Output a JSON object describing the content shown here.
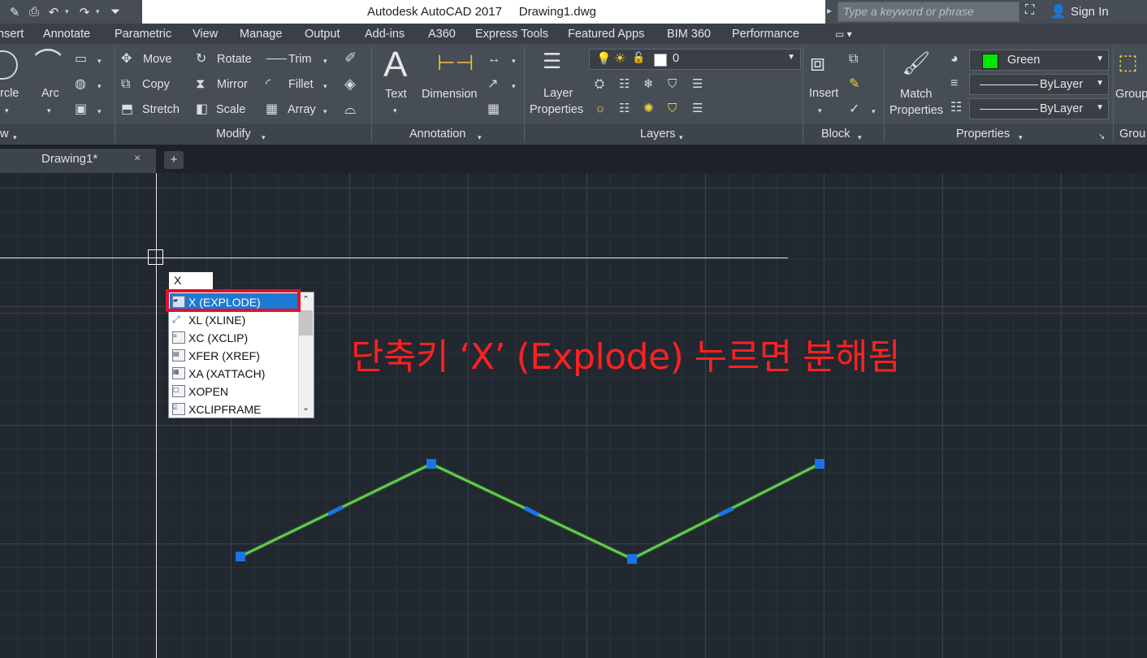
{
  "app": {
    "title": "Autodesk AutoCAD 2017     Drawing1.dwg",
    "search_placeholder": "Type a keyword or phrase",
    "sign_in": "Sign In"
  },
  "menu_tabs": [
    "nsert",
    "Annotate",
    "Parametric",
    "View",
    "Manage",
    "Output",
    "Add-ins",
    "A360",
    "Express Tools",
    "Featured Apps",
    "BIM 360",
    "Performance"
  ],
  "ribbon": {
    "draw": {
      "circle": "rcle",
      "arc": "Arc",
      "panel": "w"
    },
    "modify": {
      "move": "Move",
      "rotate": "Rotate",
      "trim": "Trim",
      "copy": "Copy",
      "mirror": "Mirror",
      "fillet": "Fillet",
      "stretch": "Stretch",
      "scale": "Scale",
      "array": "Array",
      "panel": "Modify"
    },
    "annotation": {
      "text": "Text",
      "dimension": "Dimension",
      "panel": "Annotation"
    },
    "layers": {
      "layer_properties_1": "Layer",
      "layer_properties_2": "Properties",
      "current_layer": "0",
      "panel": "Layers"
    },
    "block": {
      "insert": "Insert",
      "panel": "Block"
    },
    "properties": {
      "match_1": "Match",
      "match_2": "Properties",
      "color": "Green",
      "color_hex": "#00e600",
      "linetype": "ByLayer",
      "lineweight": "ByLayer",
      "panel": "Properties"
    },
    "groups": {
      "group": "Group",
      "panel": "Grou"
    }
  },
  "document_tab": {
    "name": "Drawing1*",
    "close": "×",
    "plus": "+"
  },
  "command_input": "X",
  "autocomplete": [
    {
      "label": "X (EXPLODE)",
      "selected": true
    },
    {
      "label": "XL (XLINE)"
    },
    {
      "label": "XC (XCLIP)"
    },
    {
      "label": "XFER (XREF)"
    },
    {
      "label": "XA (XATTACH)"
    },
    {
      "label": "XOPEN"
    },
    {
      "label": "XCLIPFRAME"
    }
  ],
  "annotation_text": "단축키 ‘X’ (Explode) 누르면 분해됨",
  "colors": {
    "accent": "#1e79d3",
    "highlight": "#e3102b",
    "polyline": "#6fcf5b",
    "grip": "#1a73e8"
  }
}
